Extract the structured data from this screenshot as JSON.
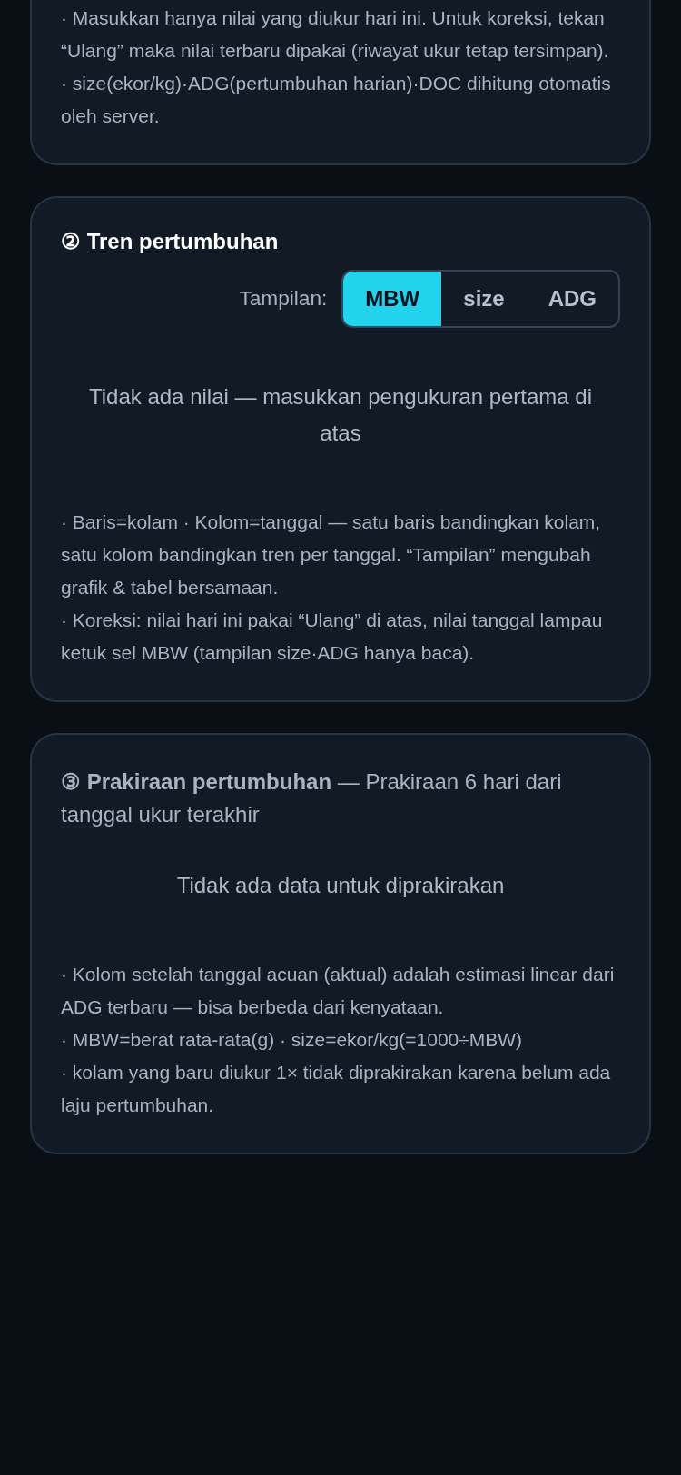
{
  "intro_notes": [
    "· Masukkan hanya nilai yang diukur hari ini. Untuk koreksi, tekan “Ulang” maka nilai terbaru dipakai (riwayat ukur tetap tersimpan).",
    "· size(ekor/kg)·ADG(pertumbuhan harian)·DOC dihitung otomatis oleh server."
  ],
  "trend": {
    "title": "② Tren pertumbuhan",
    "view_label": "Tampilan:",
    "view_options": [
      {
        "label": "MBW",
        "selected": true
      },
      {
        "label": "size",
        "selected": false
      },
      {
        "label": "ADG",
        "selected": false
      }
    ],
    "empty_message": "Tidak ada nilai — masukkan pengukuran pertama di atas",
    "notes": [
      "· Baris=kolam · Kolom=tanggal — satu baris bandingkan kolam, satu kolom bandingkan tren per tanggal. “Tampilan” mengubah grafik & tabel bersamaan.",
      "· Koreksi: nilai hari ini pakai “Ulang” di atas, nilai tanggal lampau ketuk sel MBW (tampilan size·ADG hanya baca)."
    ]
  },
  "forecast": {
    "title": "**③ Prakiraan pertumbuhan** — Prakiraan 6 hari dari tanggal ukur terakhir",
    "empty_message": "Tidak ada data untuk diprakirakan",
    "notes": [
      "· Kolom setelah tanggal acuan (aktual) adalah estimasi linear dari ADG terbaru — bisa berbeda dari kenyataan.",
      "· MBW=berat rata-rata(g) · size=ekor/kg(=1000÷MBW)",
      "· kolam yang baru diukur 1× tidak diprakirakan karena belum ada laju pertumbuhan."
    ]
  }
}
